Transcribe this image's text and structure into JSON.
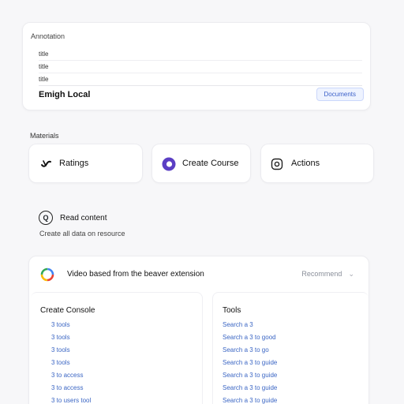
{
  "top_card": {
    "title": "Annotation",
    "rows": [
      "title",
      "title",
      "title"
    ],
    "local_label": "Emigh Local",
    "badge": "Documents"
  },
  "section_label": "Materials",
  "tiles": [
    {
      "label": "Ratings",
      "icon": "swirl-icon"
    },
    {
      "label": "Create Course",
      "icon": "purple-circle-icon"
    },
    {
      "label": "Actions",
      "icon": "q-circle-icon"
    }
  ],
  "search_hint": {
    "icon_letter": "Q",
    "title": "Read content",
    "subtitle": "Create all data on resource"
  },
  "panel": {
    "title": "Video based from the beaver extension",
    "dropdown": "Recommend",
    "left": {
      "title": "Create Console",
      "items": [
        "3 tools",
        "3 tools",
        "3 tools",
        "3 tools",
        "3 to access",
        "3 to access",
        "3 to users tool"
      ]
    },
    "right": {
      "title": "Tools",
      "items": [
        "Search a 3",
        "Search a 3 to good",
        "Search a 3 to go",
        "Search a 3 to guide",
        "Search a 3 to guide",
        "Search a 3 to guide",
        "Search a 3 to guide"
      ]
    }
  },
  "colors": {
    "accent": "#3c61c9",
    "link": "#3b66c4",
    "purple": "#5b3fc4",
    "background": "#f7f7f9"
  }
}
